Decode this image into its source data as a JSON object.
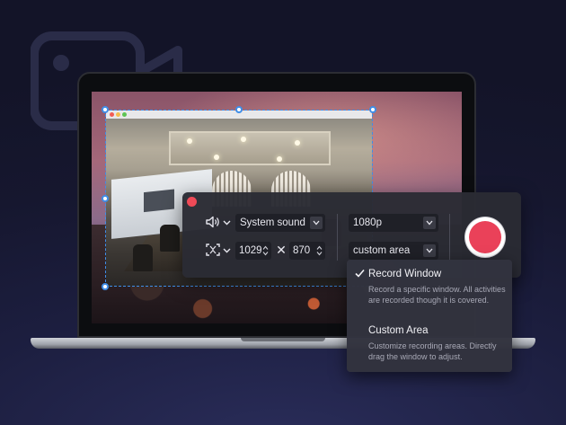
{
  "controls": {
    "audio_source": "System sound",
    "width": "1029",
    "height": "870",
    "times_sign": "✕",
    "resolution": "1080p",
    "area_mode": "custom area"
  },
  "menu": {
    "items": [
      {
        "title": "Record Window",
        "description": "Record a specific window. All activities are recorded though it is covered.",
        "checked": true
      },
      {
        "title": "Custom Area",
        "description": "Customize recording areas. Directly drag the window to adjust.",
        "checked": false
      }
    ]
  },
  "icons": {
    "background": "video-camera-icon",
    "audio": "speaker-icon",
    "region": "region-select-icon",
    "record": "record-icon",
    "close": "close-dot-icon",
    "check": "checkmark-icon"
  },
  "colors": {
    "accent_blue": "#3f8ee8",
    "record_red": "#ea4159",
    "panel_bg": "#2a2b34",
    "dropdown_bg": "#32333e"
  }
}
